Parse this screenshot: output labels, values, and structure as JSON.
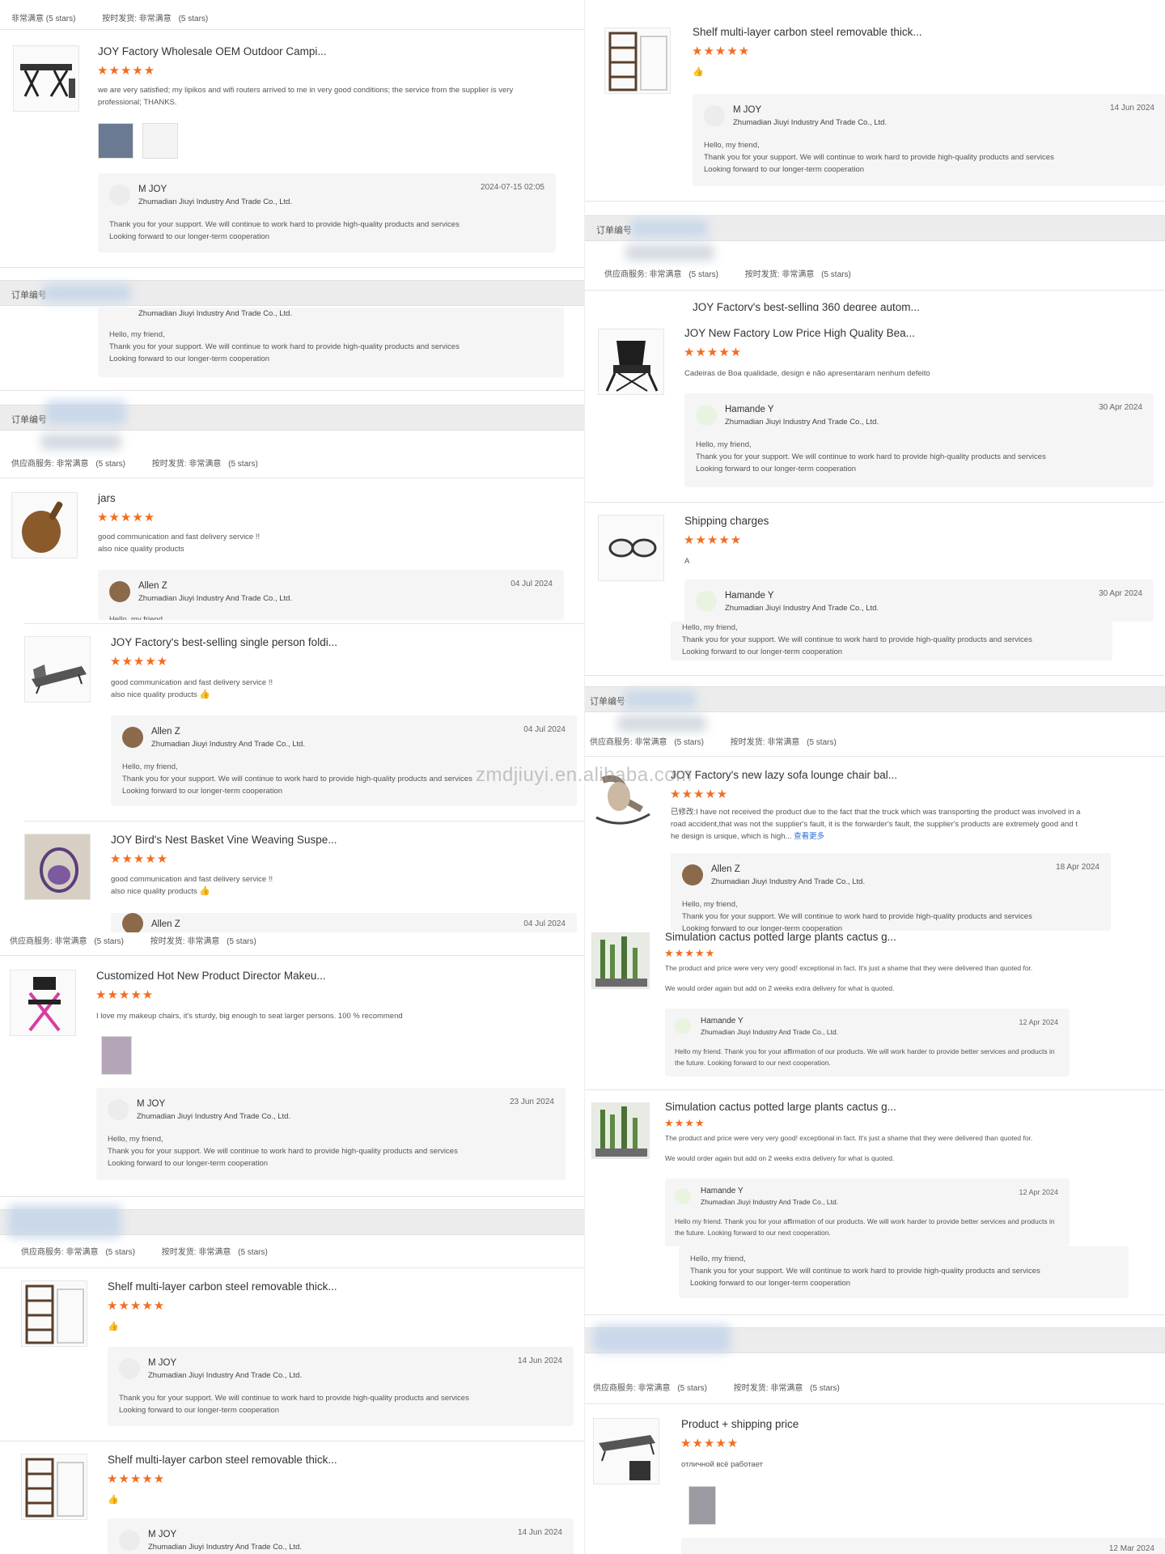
{
  "labels": {
    "order_no": "订单编号",
    "supplier_service": "供应商服务: 非常满意",
    "on_time": "按时发货: 非常满意",
    "five_stars": "(5 stars)",
    "company": "Zhumadian Jiuyi Industry And Trade Co., Ltd.",
    "star_glyphs": "★★★★★",
    "star_glyphs_4": "★★★★",
    "thumb_up": "👍",
    "watermark": "zmdjiuyi.en.alibaba.com",
    "reply_hello": "Hello, my friend,",
    "reply_thanks": "Thank you for your support. We will continue to work hard to provide high-quality products and services",
    "reply_forward": "Looking forward to our longer-term cooperation",
    "reply_short": "Hello my friend. Thank you for your affirmation of our products. We will work harder to provide better services and products in the future. Looking forward to our next cooperation."
  },
  "left": {
    "top_meta_stars": "非常满意  (5 stars)",
    "r1": {
      "title": "JOY Factory Wholesale OEM Outdoor Campi...",
      "text": "we are very satisfied; my lipikos and wifi routers arrived to me in very good conditions; the service from the supplier is very professional; THANKS.",
      "reply_name": "M JOY",
      "reply_date": "2024-07-15 02:05"
    },
    "r2_fragment": {
      "company": "Zhumadian Jiuyi Industry And Trade Co., Ltd."
    },
    "r3": {
      "title": "jars",
      "text1": "good communication and fast delivery service !!",
      "text2": "also nice quality products",
      "reply_name": "Allen Z",
      "reply_date": "04 Jul 2024",
      "reply_fragment": "Hello, my friend"
    },
    "r4": {
      "title": "JOY Factory's best-selling single person foldi...",
      "text1": "good communication and fast delivery service !!",
      "text2": "also nice quality products",
      "reply_name": "Allen Z",
      "reply_date": "04 Jul 2024"
    },
    "r5": {
      "title": "JOY Bird's Nest Basket Vine Weaving Suspe...",
      "text1": "good communication and fast delivery service !!",
      "text2": "also nice quality products",
      "reply_name": "Allen Z",
      "reply_date": "04 Jul 2024"
    },
    "r6": {
      "title": "Customized Hot New Product Director Makeu...",
      "text": "I love my makeup chairs, it's sturdy, big enough to seat larger persons. 100 % recommend",
      "reply_name": "M JOY",
      "reply_date": "23 Jun 2024"
    },
    "r7": {
      "title": "Shelf multi-layer carbon steel removable thick...",
      "reply_name": "M JOY",
      "reply_date": "14 Jun 2024"
    },
    "r8": {
      "title": "Shelf multi-layer carbon steel removable thick...",
      "reply_name": "M JOY",
      "reply_date": "14 Jun 2024"
    }
  },
  "right": {
    "r1": {
      "title": "Shelf multi-layer carbon steel removable thick...",
      "reply_name": "M JOY",
      "reply_date": "14 Jun 2024"
    },
    "r2_cut_title": "JOY Factory's best-selling 360 degree autom...",
    "r2": {
      "title": "JOY New Factory Low Price High Quality Bea...",
      "text": "Cadeiras de Boa qualidade, design e não apresentaram nenhum defeito",
      "reply_name": "Hamande Y",
      "reply_date": "30 Apr 2024"
    },
    "r3": {
      "title": "Shipping charges",
      "text": "A",
      "reply_name": "Hamande Y",
      "reply_date": "30 Apr 2024",
      "reply_fragment": "Hello, my friend,"
    },
    "r4": {
      "title": "JOY Factory's new lazy sofa lounge chair bal...",
      "edited": "已修改:",
      "text": "I have not received the product due to the fact that the truck which was transporting the product was involved in a road accident,that was not the supplier's fault, it is the forwarder's fault, the supplier's products are extremely good and t he design is unique, which is high...",
      "more": "查看更多",
      "reply_name": "Allen Z",
      "reply_date": "18 Apr 2024"
    },
    "r5": {
      "title": "Simulation cactus potted large plants cactus g...",
      "text1": "The product and price were very very good! exceptional in fact. It's just a shame that they were delivered than quoted for.",
      "text2": "We would order again but add on 2 weeks extra delivery for what is quoted.",
      "reply_name": "Hamande Y",
      "reply_date": "12 Apr 2024"
    },
    "r6": {
      "title": "Simulation cactus potted large plants cactus g...",
      "text1": "The product and price were very very good! exceptional in fact. It's just a shame that they were delivered than quoted for.",
      "text2": "We would order again but add on 2 weeks extra delivery for what is quoted.",
      "reply_name": "Hamande Y",
      "reply_date": "12 Apr 2024"
    },
    "r7": {
      "title": "Product + shipping price",
      "text": "отличной всё работает",
      "reply_date": "12 Mar 2024"
    }
  }
}
